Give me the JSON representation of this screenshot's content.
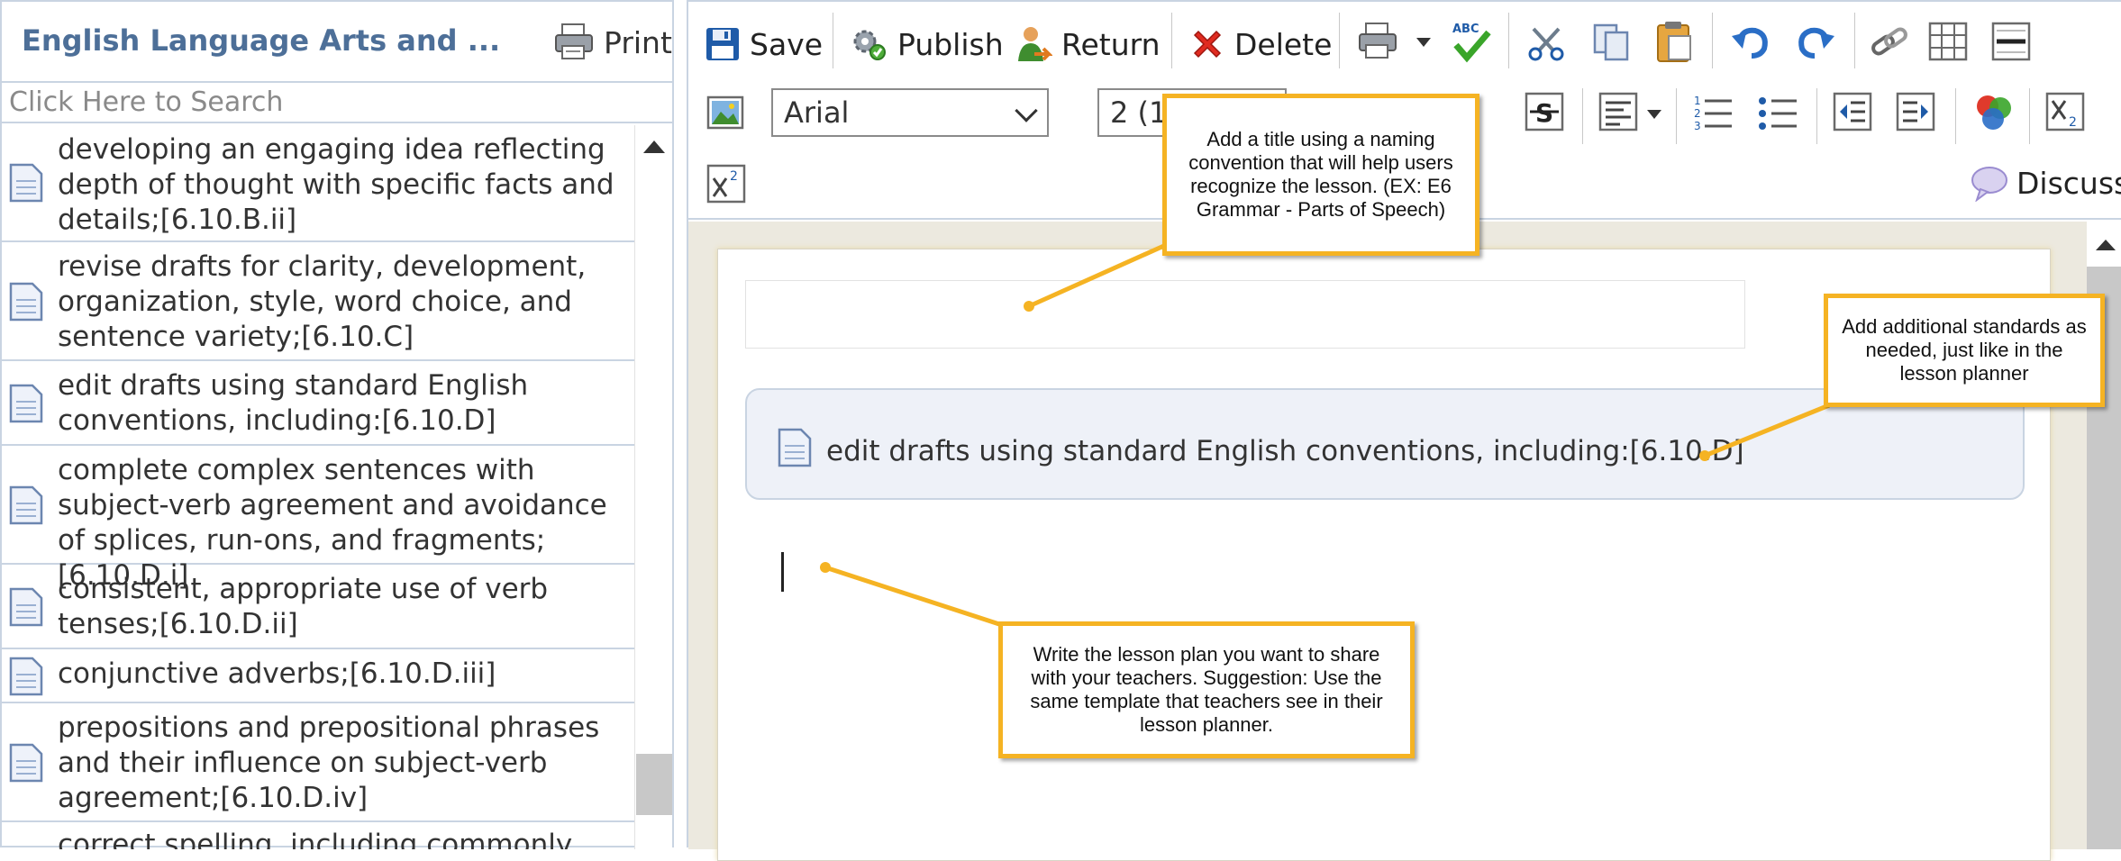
{
  "left_panel": {
    "title": "English Language Arts and ...",
    "print_label": "Print",
    "search_placeholder": "Click Here to Search",
    "items": [
      {
        "text": "developing an engaging idea reflecting depth of thought with specific facts and details;[6.10.B.ii]"
      },
      {
        "text": "revise drafts for clarity, development, organization, style, word choice, and sentence variety;[6.10.C]"
      },
      {
        "text": "edit drafts using standard English conventions, including:[6.10.D]"
      },
      {
        "text": "complete complex sentences with subject-verb agreement and avoidance of splices, run-ons, and fragments;[6.10.D.i]"
      },
      {
        "text": "consistent, appropriate use of verb tenses;[6.10.D.ii]"
      },
      {
        "text": "conjunctive adverbs;[6.10.D.iii]"
      },
      {
        "text": "prepositions and prepositional phrases and their influence on subject-verb agreement;[6.10.D.iv]"
      },
      {
        "text": "correct spelling, including commonly"
      }
    ]
  },
  "toolbar": {
    "save_label": "Save",
    "publish_label": "Publish",
    "return_label": "Return",
    "delete_label": "Delete",
    "font_value": "Arial",
    "size_value": "2 (1",
    "discuss_label": "Discuss"
  },
  "editor": {
    "standard_card_text": "edit drafts using standard English conventions, including:[6.10.D]"
  },
  "callouts": {
    "title": "Add a title using a naming convention that will help users recognize the lesson.  (EX: E6 Grammar - Parts of Speech)",
    "standards": "Add additional standards as needed, just like in the lesson planner",
    "lesson": "Write the lesson plan you want to share with your teachers.  Suggestion:  Use the same template that teachers see in their lesson planner."
  },
  "colors": {
    "accent_title": "#4d6f98",
    "border": "#c9d4e2",
    "callout_border": "#f5b323",
    "delete_red": "#e02b20",
    "save_blue": "#1f5ba8"
  }
}
